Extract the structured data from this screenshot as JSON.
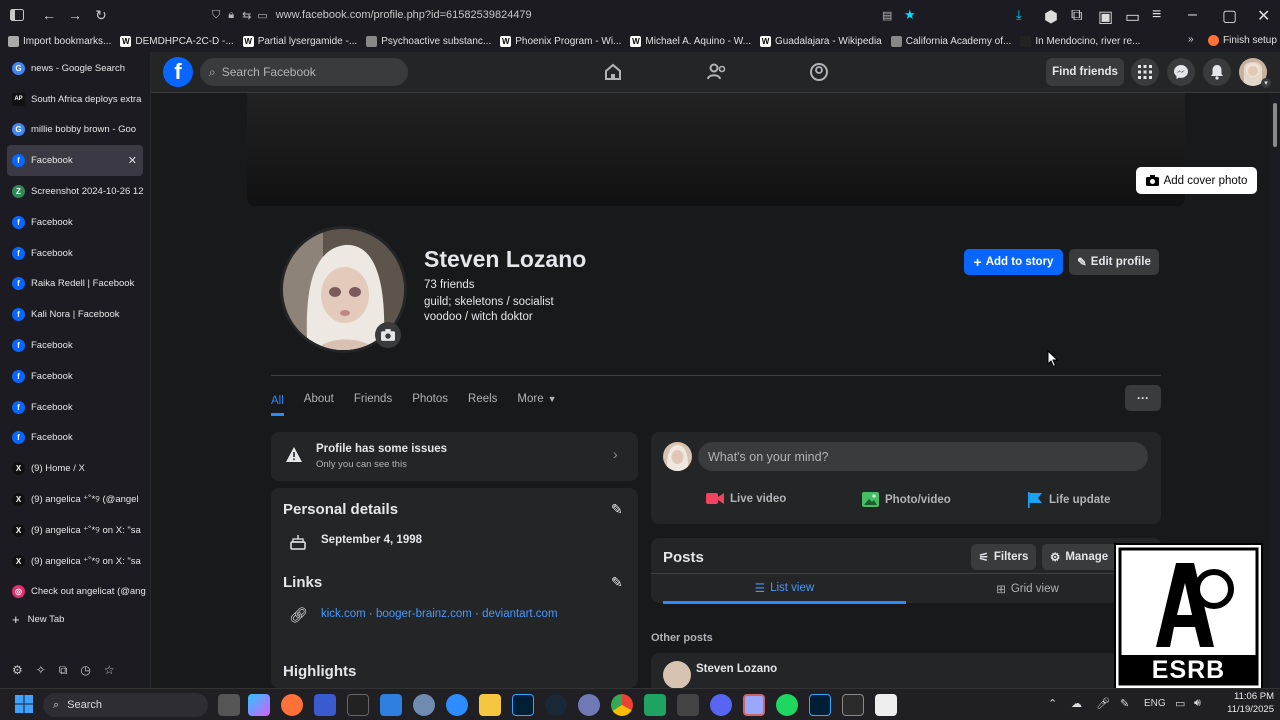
{
  "browser": {
    "url": "www.facebook.com/profile.php?id=61582539824479"
  },
  "bookmarks": [
    {
      "label": "Import bookmarks...",
      "icon": "import-icon"
    },
    {
      "label": "DEMDHPCA-2C-D -...",
      "icon": "wikipedia-icon"
    },
    {
      "label": "Partial lysergamide -...",
      "icon": "wikipedia-icon"
    },
    {
      "label": "Psychoactive substanc...",
      "icon": "site-icon"
    },
    {
      "label": "Phoenix Program - Wi...",
      "icon": "wikipedia-icon"
    },
    {
      "label": "Michael A. Aquino - W...",
      "icon": "wikipedia-icon"
    },
    {
      "label": "Guadalajara - Wikipedia",
      "icon": "wikipedia-icon"
    },
    {
      "label": "California Academy of...",
      "icon": "site-icon"
    },
    {
      "label": "In Mendocino, river re...",
      "icon": "news-icon"
    }
  ],
  "bookmarks_more": "Finish setup",
  "tabs": [
    {
      "label": "news - Google Search",
      "icon": "google-icon"
    },
    {
      "label": "South Africa deploys extra",
      "icon": "ap-icon"
    },
    {
      "label": "millie bobby brown - Goo",
      "icon": "google-icon"
    },
    {
      "label": "Facebook",
      "icon": "facebook-icon",
      "active": true
    },
    {
      "label": "Screenshot 2024-10-26 12",
      "icon": "image-icon"
    },
    {
      "label": "Facebook",
      "icon": "facebook-icon"
    },
    {
      "label": "Facebook",
      "icon": "facebook-icon"
    },
    {
      "label": "Raika Redell | Facebook",
      "icon": "facebook-icon"
    },
    {
      "label": "Kali Nora | Facebook",
      "icon": "facebook-icon"
    },
    {
      "label": "Facebook",
      "icon": "facebook-icon"
    },
    {
      "label": "Facebook",
      "icon": "facebook-icon"
    },
    {
      "label": "Facebook",
      "icon": "facebook-icon"
    },
    {
      "label": "Facebook",
      "icon": "facebook-icon"
    },
    {
      "label": "(9) Home / X",
      "icon": "x-icon"
    },
    {
      "label": "(9) angelica ⁺˚*୨ (@angel",
      "icon": "x-icon"
    },
    {
      "label": "(9) angelica ⁺˚*୨ on X: \"sa",
      "icon": "x-icon"
    },
    {
      "label": "(9) angelica ⁺˚*୨ on X: \"sa",
      "icon": "x-icon"
    },
    {
      "label": "Check out angelicat (@ang",
      "icon": "instagram-icon"
    }
  ],
  "new_tab": "New Tab",
  "fb": {
    "search_placeholder": "Search Facebook",
    "find_friends": "Find friends"
  },
  "profile": {
    "add_cover": "Add cover photo",
    "name": "Steven Lozano",
    "friends": "73 friends",
    "bio_line1": "guild; skeletons / socialist",
    "bio_line2": "voodoo / witch doktor",
    "add_story": "Add to story",
    "edit_profile": "Edit profile",
    "tabs": [
      "All",
      "About",
      "Friends",
      "Photos",
      "Reels",
      "More"
    ],
    "more_dots": "···"
  },
  "issues": {
    "title": "Profile has some issues",
    "subtitle": "Only you can see this"
  },
  "details": {
    "heading": "Personal details",
    "birthday": "September 4, 1998",
    "links_heading": "Links",
    "links": [
      "kick.com",
      "booger-brainz.com",
      "deviantart.com"
    ],
    "highlights_heading": "Highlights"
  },
  "compose": {
    "placeholder": "What's on your mind?",
    "live": "Live video",
    "photo": "Photo/video",
    "life": "Life update"
  },
  "posts": {
    "heading": "Posts",
    "filters": "Filters",
    "manage": "Manage",
    "list_view": "List view",
    "grid_view": "Grid view",
    "other_posts": "Other posts",
    "author": "Steven Lozano"
  },
  "esrb": {
    "label": "ESRB"
  },
  "taskbar": {
    "search": "Search",
    "lang": "ENG",
    "time": "11:06 PM",
    "date": "11/19/2025"
  },
  "colors": {
    "fb_blue": "#0866ff",
    "link_blue": "#4599ff"
  }
}
